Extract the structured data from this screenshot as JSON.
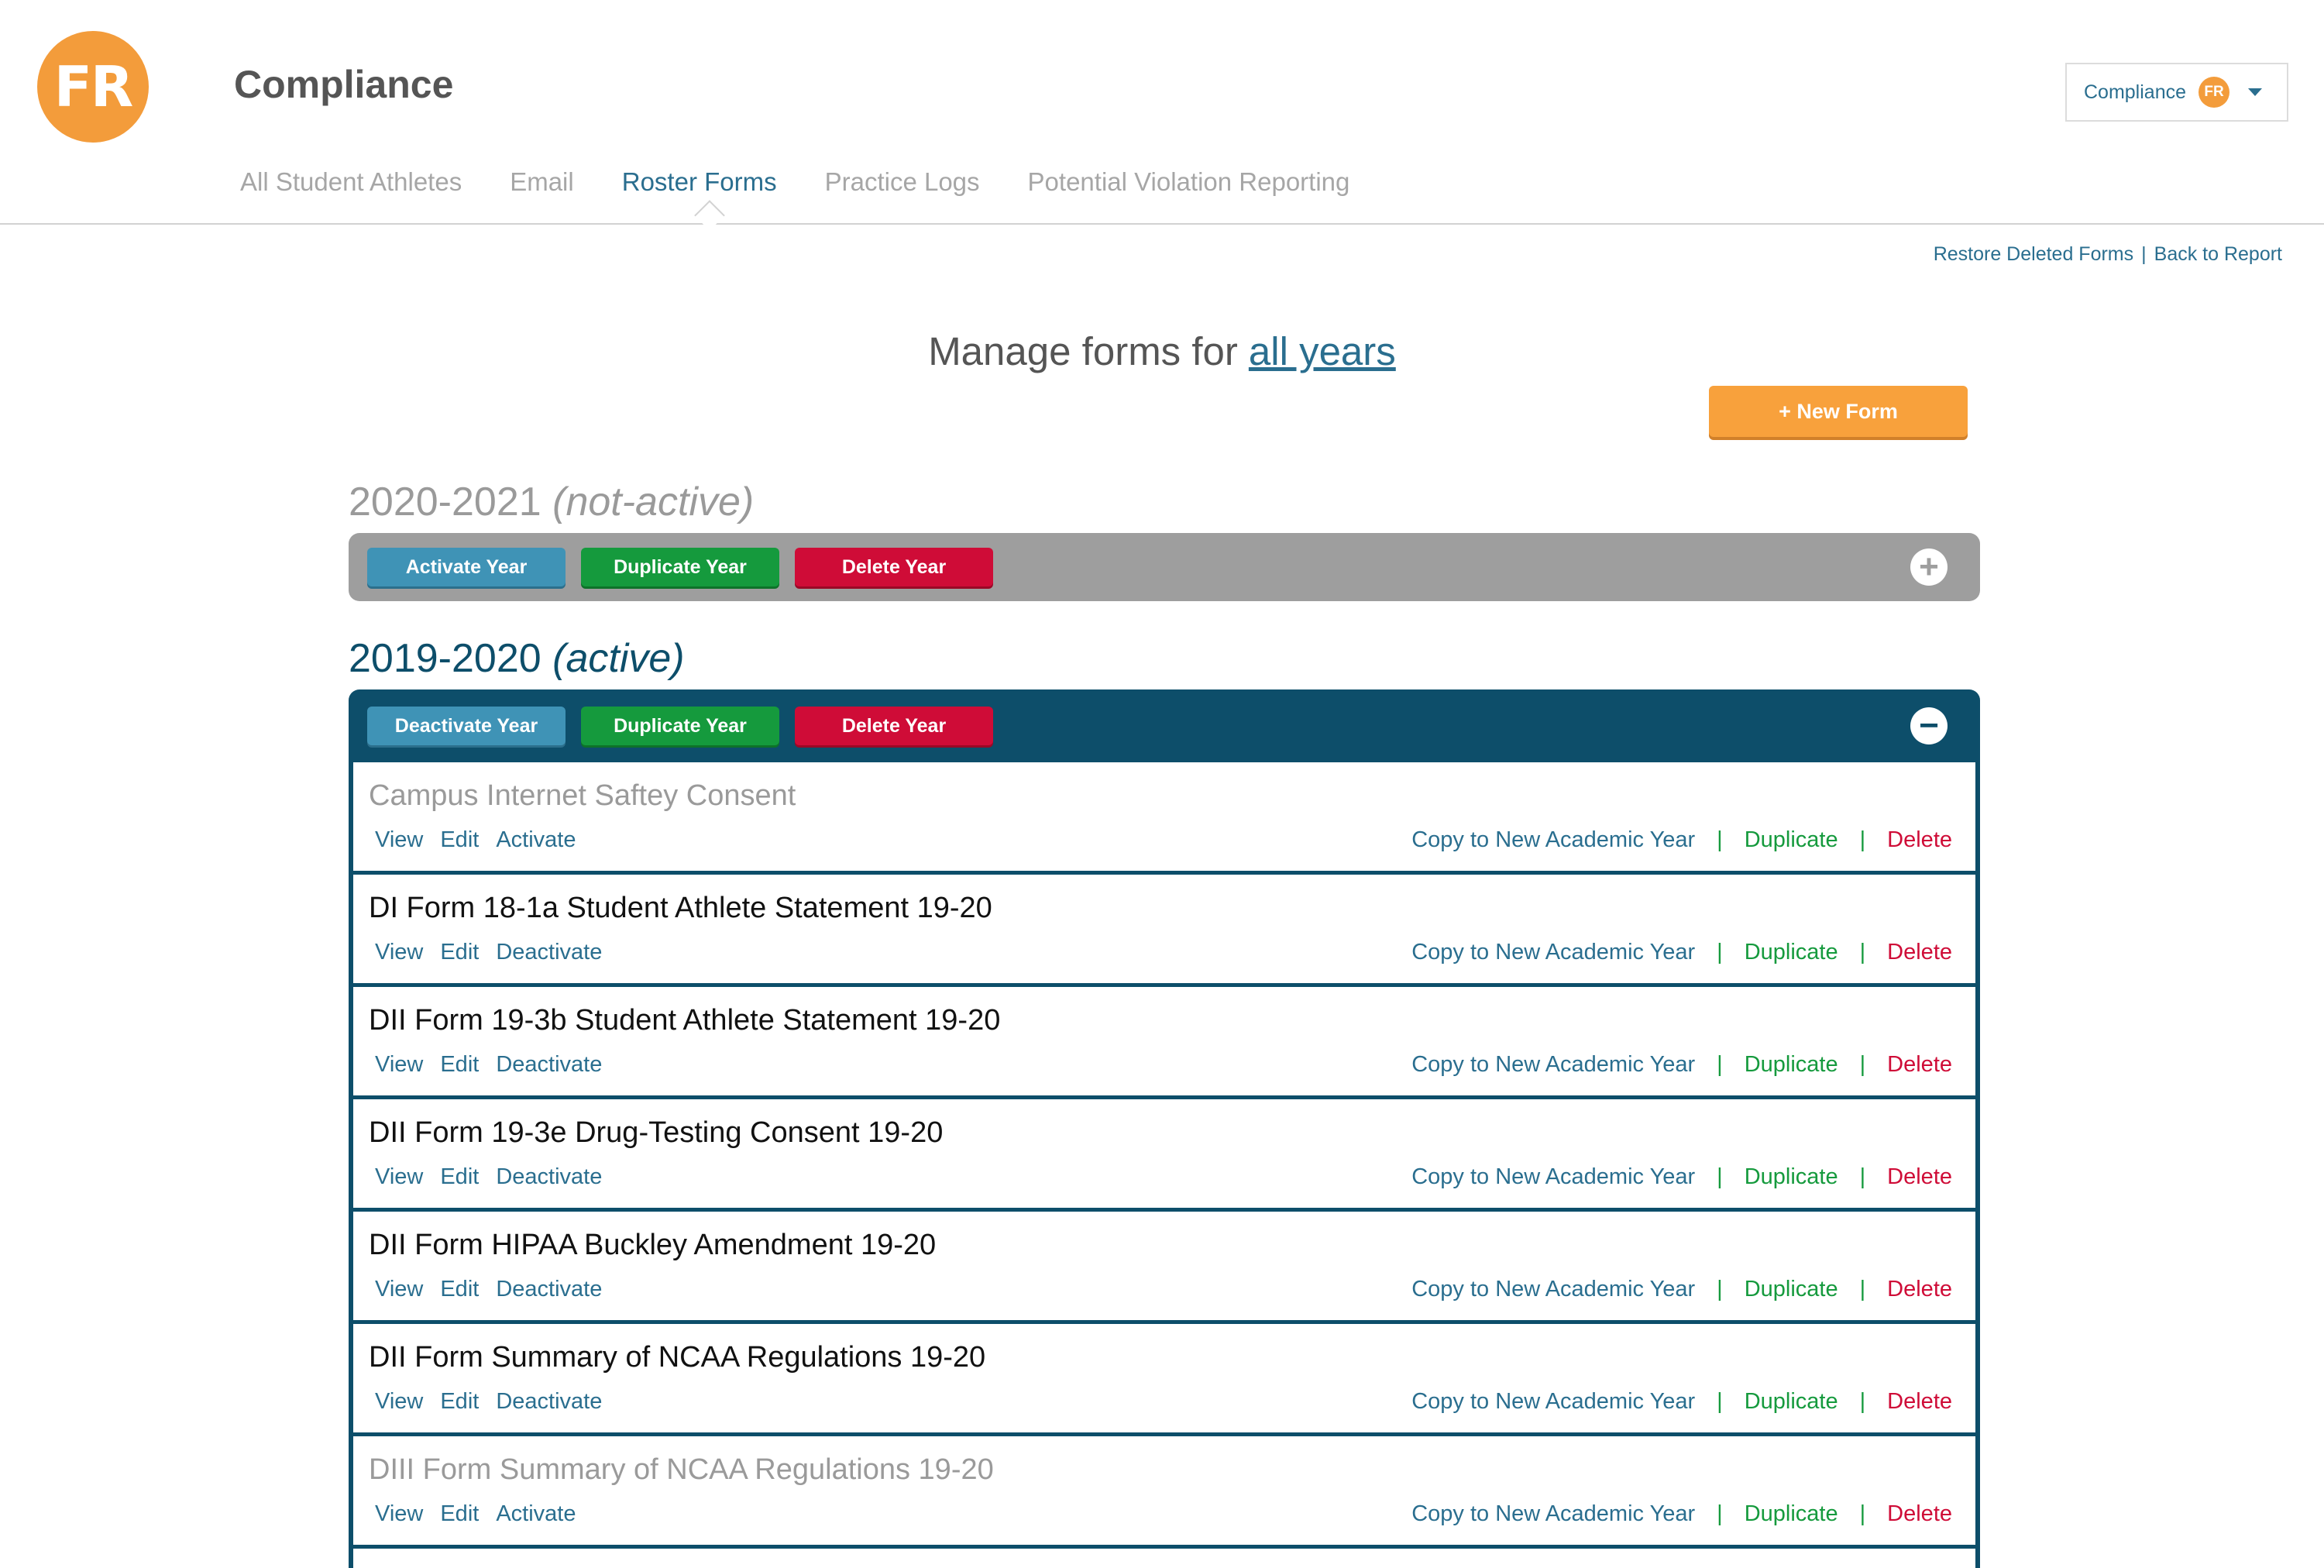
{
  "header": {
    "logo_text": "FR",
    "app_title": "Compliance",
    "user_menu": {
      "label": "Compliance",
      "badge": "FR"
    }
  },
  "nav": {
    "tabs": [
      {
        "label": "All Student Athletes"
      },
      {
        "label": "Email"
      },
      {
        "label": "Roster Forms",
        "active": true
      },
      {
        "label": "Practice Logs"
      },
      {
        "label": "Potential Violation Reporting"
      }
    ]
  },
  "toplinks": {
    "restore": "Restore Deleted Forms",
    "separator": "|",
    "back": "Back to Report"
  },
  "manage": {
    "prefix": "Manage forms  for",
    "years_link": "all years"
  },
  "new_form_button": "+ New Form",
  "years": [
    {
      "range": "2020-2021",
      "status": "(not-active)",
      "buttons": {
        "activate": "Activate Year",
        "duplicate": "Duplicate Year",
        "delete": "Delete Year"
      },
      "toggle": "+"
    },
    {
      "range": "2019-2020",
      "status": "(active)",
      "buttons": {
        "activate": "Deactivate Year",
        "duplicate": "Duplicate Year",
        "delete": "Delete Year"
      },
      "toggle": "−"
    }
  ],
  "row_labels": {
    "view": "View",
    "edit": "Edit",
    "copy": "Copy to New Academic Year",
    "duplicate": "Duplicate",
    "delete": "Delete",
    "pipe": "|"
  },
  "forms": [
    {
      "title": "Campus Internet Saftey Consent",
      "toggle_label": "Activate",
      "inactive": true
    },
    {
      "title": "DI Form 18-1a Student Athlete Statement 19-20",
      "toggle_label": "Deactivate",
      "inactive": false
    },
    {
      "title": "DII Form 19-3b Student Athlete Statement 19-20",
      "toggle_label": "Deactivate",
      "inactive": false
    },
    {
      "title": "DII Form 19-3e Drug-Testing Consent 19-20",
      "toggle_label": "Deactivate",
      "inactive": false
    },
    {
      "title": "DII Form HIPAA Buckley Amendment 19-20",
      "toggle_label": "Deactivate",
      "inactive": false
    },
    {
      "title": "DII Form Summary of NCAA Regulations 19-20",
      "toggle_label": "Deactivate",
      "inactive": false
    },
    {
      "title": "DIII Form Summary of NCAA Regulations 19-20",
      "toggle_label": "Activate",
      "inactive": true
    }
  ],
  "colors": {
    "brand_orange": "#f39c3b",
    "link_blue": "#2a6e8f",
    "active_year_bar": "#0d4e6a",
    "inactive_year_bar": "#9e9e9e",
    "green": "#159a3d",
    "red": "#cf0c37"
  }
}
